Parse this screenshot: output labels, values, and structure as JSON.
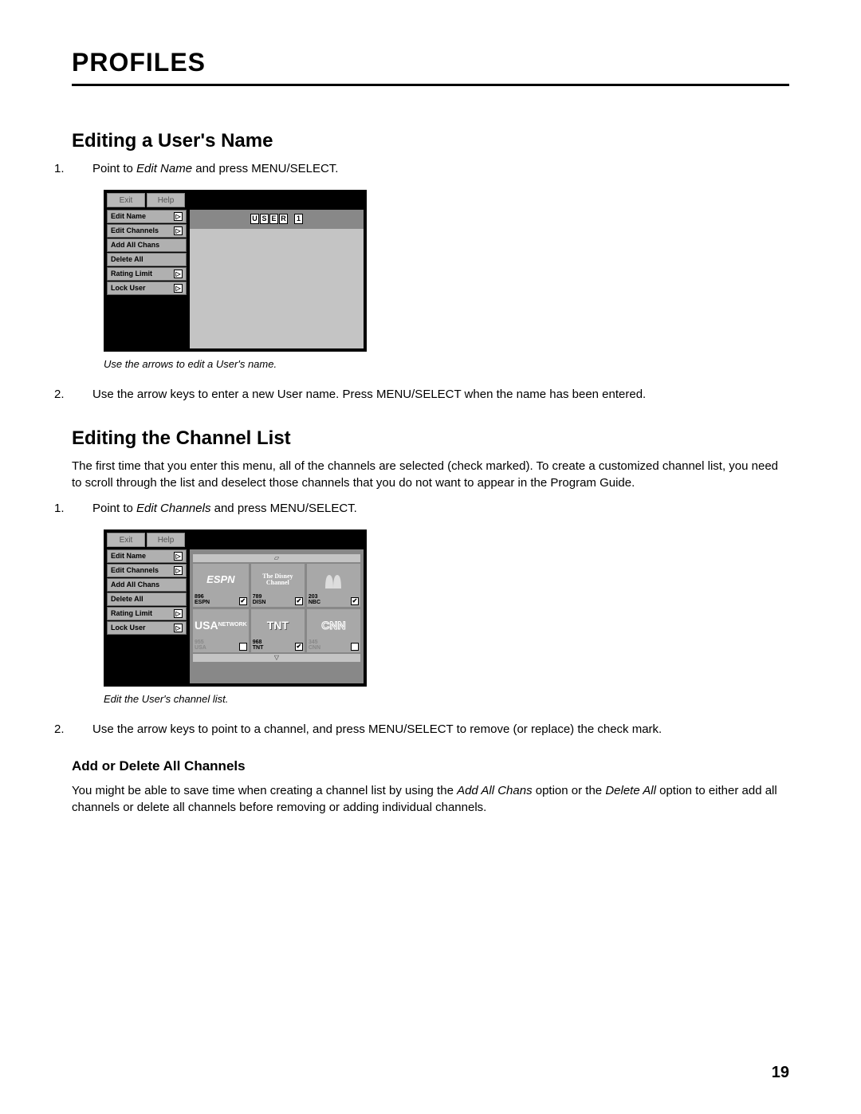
{
  "page_title": "PROFILES",
  "page_number": "19",
  "sections": {
    "edit_name": {
      "heading": "Editing a User's Name",
      "step1_pre": "Point to ",
      "step1_ital": "Edit Name",
      "step1_post": " and press MENU/SELECT.",
      "caption": "Use the arrows to edit a User's name.",
      "step2": "Use the arrow keys to enter a new User name. Press MENU/SELECT when the name has been entered."
    },
    "edit_channels": {
      "heading": "Editing the Channel List",
      "intro": "The first time that you enter this menu, all of the channels are selected (check marked). To create a customized channel list, you need to scroll through the list and deselect those channels that you do not want to appear in the Program Guide.",
      "step1_pre": "Point to ",
      "step1_ital": "Edit Channels",
      "step1_post": " and press MENU/SELECT.",
      "caption": "Edit the User's channel list.",
      "step2": "Use the arrow keys to point to a channel, and press MENU/SELECT to remove (or replace) the check mark."
    },
    "add_delete": {
      "heading": "Add or Delete All Channels",
      "body_pre": "You might be able to save time when creating a channel list by using the ",
      "body_ital1": "Add All Chans",
      "body_mid": " option or the ",
      "body_ital2": "Delete All",
      "body_post": " option to either add all channels or delete all channels before removing or adding individual channels."
    }
  },
  "ui": {
    "top_buttons": {
      "exit": "Exit",
      "help": "Help"
    },
    "sidebar_items": [
      {
        "label": "Edit Name",
        "arrow": true
      },
      {
        "label": "Edit Channels",
        "arrow": true
      },
      {
        "label": "Add All Chans",
        "arrow": false
      },
      {
        "label": "Delete All",
        "arrow": false
      },
      {
        "label": "Rating Limit",
        "arrow": true
      },
      {
        "label": "Lock User",
        "arrow": true
      }
    ],
    "name_letters": [
      "U",
      "S",
      "E",
      "R",
      "",
      "1"
    ],
    "channels": [
      {
        "logo": "ESPN",
        "num": "896",
        "code": "ESPN",
        "checked": true
      },
      {
        "logo": "The Disney Channel",
        "num": "789",
        "code": "DISN",
        "checked": true
      },
      {
        "logo": "NBC",
        "num": "203",
        "code": "NBC",
        "checked": true
      },
      {
        "logo": "USA NETWORK",
        "num": "955",
        "code": "USA",
        "checked": false
      },
      {
        "logo": "TNT",
        "num": "968",
        "code": "TNT",
        "checked": true
      },
      {
        "logo": "CNN",
        "num": "345",
        "code": "CNN",
        "checked": false
      }
    ]
  }
}
